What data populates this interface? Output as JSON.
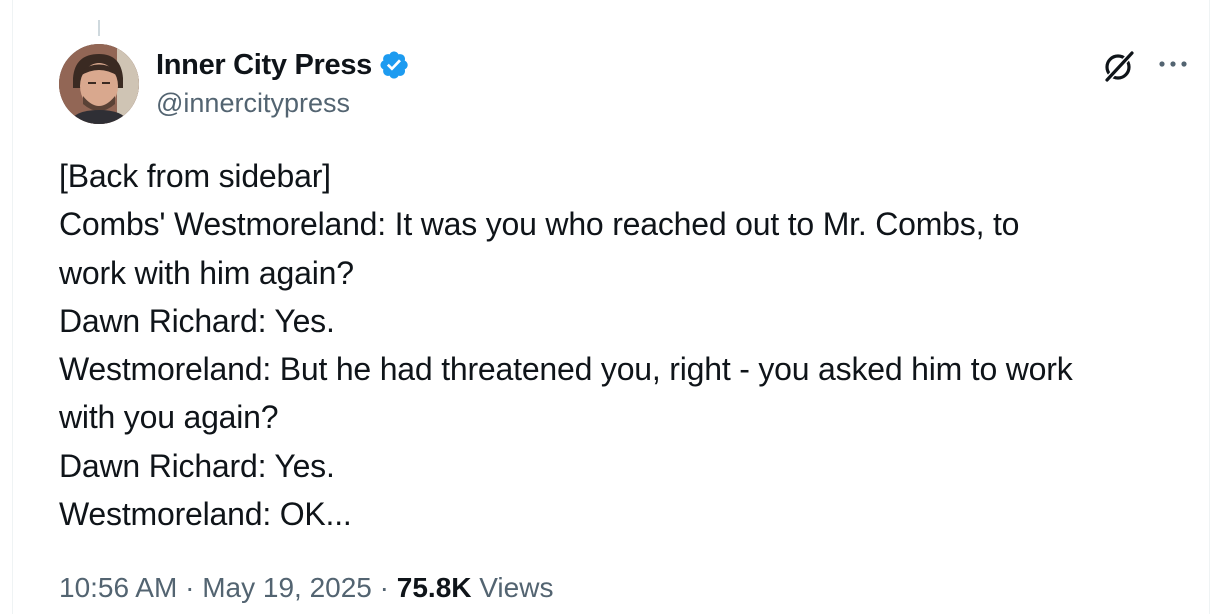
{
  "tweet": {
    "author": {
      "display_name": "Inner City Press",
      "handle": "@innercitypress",
      "verified": true
    },
    "lines": [
      "[Back from sidebar]",
      "Combs' Westmoreland: It was you who reached out to Mr. Combs, to",
      "work with him again?",
      "Dawn Richard: Yes.",
      "Westmoreland: But he had threatened you, right - you asked him to work",
      "with you again?",
      "Dawn Richard: Yes.",
      "Westmoreland: OK..."
    ],
    "time": "10:56 AM",
    "date": "May 19, 2025",
    "separator": " · ",
    "views_count": "75.8K",
    "views_label": "Views"
  },
  "icons": {
    "verified": "verified-badge-icon",
    "grok": "grok-icon",
    "more": "more-options-icon"
  },
  "colors": {
    "text_primary": "#0f1419",
    "text_secondary": "#536471",
    "verified_blue": "#1d9bf0",
    "border": "#eff3f4"
  }
}
